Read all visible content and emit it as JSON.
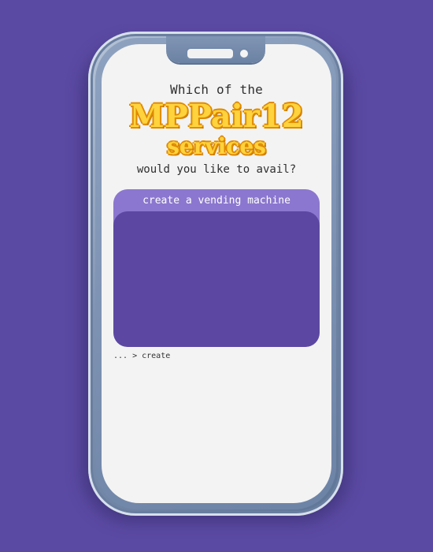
{
  "prompt": {
    "line1": "Which of the",
    "brand": "MPPair12",
    "services": "services",
    "line2": "would you like to avail?"
  },
  "card": {
    "header_label": "create a vending machine"
  },
  "breadcrumb": {
    "text": "... > create"
  },
  "colors": {
    "background": "#5b4aa3",
    "card_header": "#8b77cf",
    "card_body": "#5c48a2",
    "brand_fill": "#ffd33d",
    "brand_outline": "#e08a00"
  }
}
